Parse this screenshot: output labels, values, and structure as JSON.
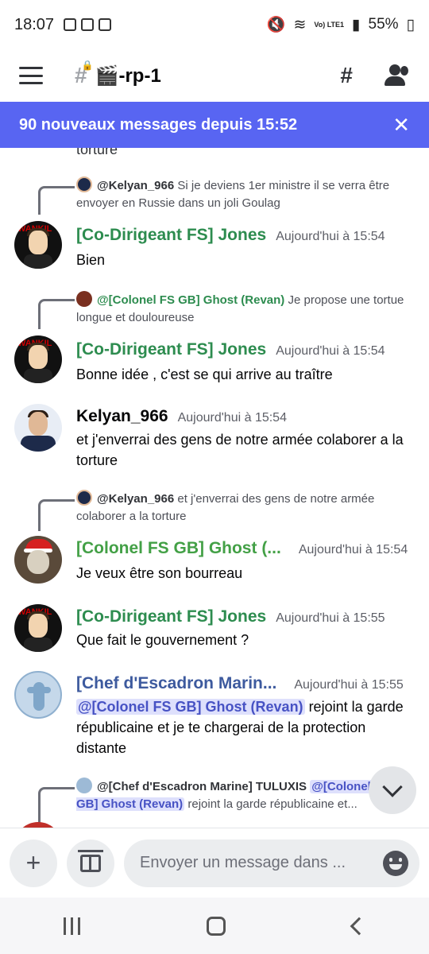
{
  "status": {
    "time": "18:07",
    "battery": "55%",
    "net": "Vo) LTE1"
  },
  "header": {
    "channel": "🎬-rp-1"
  },
  "banner": {
    "text": "90 nouveaux messages depuis 15:52"
  },
  "fragment": "torture",
  "messages": [
    {
      "reply_name": "@Kelyan_966",
      "reply_text": "Si je deviens 1er ministre il se verra être envoyer en Russie dans un joli Goulag",
      "user": "[Co-Dirigeant FS] Jones",
      "time": "Aujourd'hui à 15:54",
      "text": "Bien"
    },
    {
      "reply_name": "@[Colonel FS GB] Ghost (Revan)",
      "reply_text": "Je propose une tortue longue et douloureuse",
      "user": "[Co-Dirigeant FS] Jones",
      "time": "Aujourd'hui à 15:54",
      "text": "Bonne idée , c'est se qui arrive au traître"
    },
    {
      "user": "Kelyan_966",
      "time": "Aujourd'hui à 15:54",
      "text": "et j'enverrai des gens de notre armée colaborer a la torture"
    },
    {
      "reply_name": "@Kelyan_966",
      "reply_text": "et j'enverrai des gens de notre armée colaborer a la torture",
      "user": "[Colonel FS GB] Ghost (...",
      "time": "Aujourd'hui à 15:54",
      "text": "Je veux être son bourreau"
    },
    {
      "user": "[Co-Dirigeant FS] Jones",
      "time": "Aujourd'hui à 15:55",
      "text": "Que fait le gouvernement ?"
    },
    {
      "user": "[Chef d'Escadron Marin...",
      "time": "Aujourd'hui à 15:55",
      "mention": "@[Colonel FS GB] Ghost (Revan)",
      "text": " rejoint la garde républicaine et je te chargerai de la protection distante"
    },
    {
      "reply_name": "@[Chef d'Escadron Marine] TULUXIS",
      "reply_mention": "@[Colonel FS GB] Ghost (Revan)",
      "reply_text": " rejoint la garde républicaine et..."
    }
  ],
  "composer": {
    "placeholder": "Envoyer un message dans ..."
  }
}
